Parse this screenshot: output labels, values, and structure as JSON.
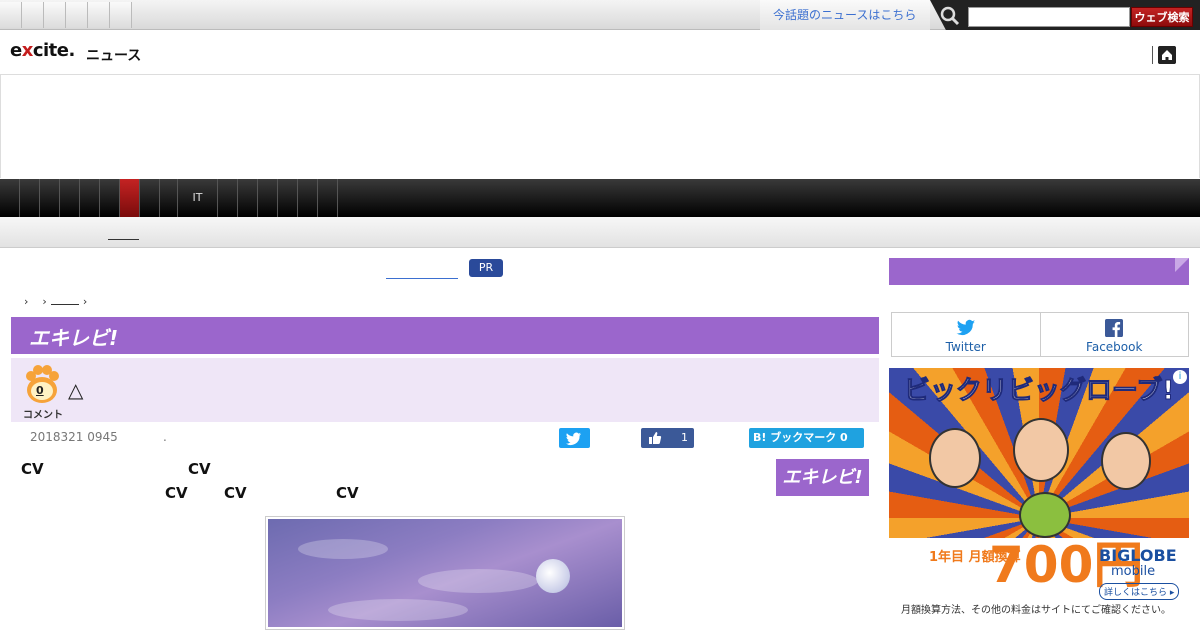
{
  "topbar": {
    "trend_label": "今話題のニュースはこちら",
    "search_placeholder": "",
    "search_button": "ウェブ検索"
  },
  "header": {
    "logo_text_e": "e",
    "logo_text_x": "x",
    "logo_text_rest": "cite.",
    "logo_sub": "ニュース"
  },
  "nav": {
    "category_it": "IT"
  },
  "promo": {
    "pr_badge": "PR"
  },
  "article": {
    "banner_label": "エキレビ!",
    "comment_count": "0",
    "comment_label": "コメント",
    "title": "△",
    "date": "2018321 0945",
    "date_separator": ".",
    "like_count": "1",
    "hatena_label": "B! ブックマーク 0",
    "exlogo_label": "エキレビ!",
    "text_cv1": "CV",
    "text_cv2": "CV",
    "text_cv3": "CV",
    "text_cv4": "CV",
    "text_cv5": "CV"
  },
  "sidebar": {
    "share_twitter": "Twitter",
    "share_facebook": "Facebook",
    "ad": {
      "headline": "ビックリビッグローブ!",
      "price": "700円",
      "year_label": "1年目 月額換算",
      "brand": "BIGLOBE",
      "brand_sub": "mobile",
      "more": "詳しくはこちら ▸",
      "footnote": "月額換算方法、その他の料金はサイトにてご確認ください。"
    }
  },
  "colors": {
    "accent_purple": "#9b66cc",
    "twitter_blue": "#1da1f2",
    "facebook_blue": "#3b5998",
    "search_red": "#c42323"
  }
}
